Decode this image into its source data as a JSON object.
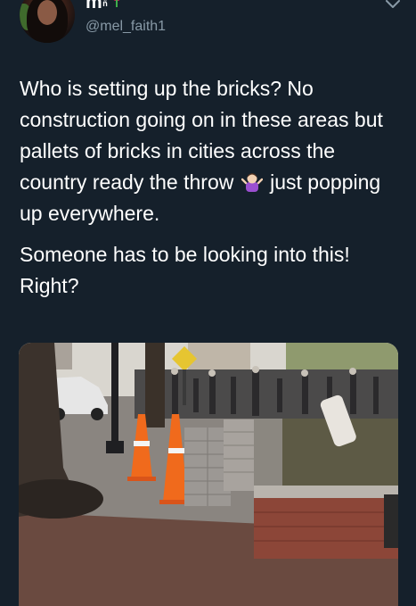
{
  "tweet": {
    "display_name": "m",
    "display_name_sup": "ñ",
    "handle": "@mel_faith1",
    "paragraphs": [
      {
        "before_emoji": "Who is setting up the bricks? No construction going on in these areas but pallets of bricks in cities across the country ready the throw ",
        "after_emoji": " just popping up everywhere."
      },
      {
        "text": "Someone has to be looking into this! Right?"
      }
    ],
    "emoji": "woman-shrugging-emoji",
    "name_emoji": "rose-icon",
    "menu_icon": "chevron-down-icon"
  },
  "media": {
    "kind": "photo",
    "subject": "street-scene-pallets-of-bricks-crowd"
  },
  "colors": {
    "background": "#15202b",
    "text_primary": "#ffffff",
    "text_secondary": "#8899a6",
    "rose": "#e0245e"
  }
}
